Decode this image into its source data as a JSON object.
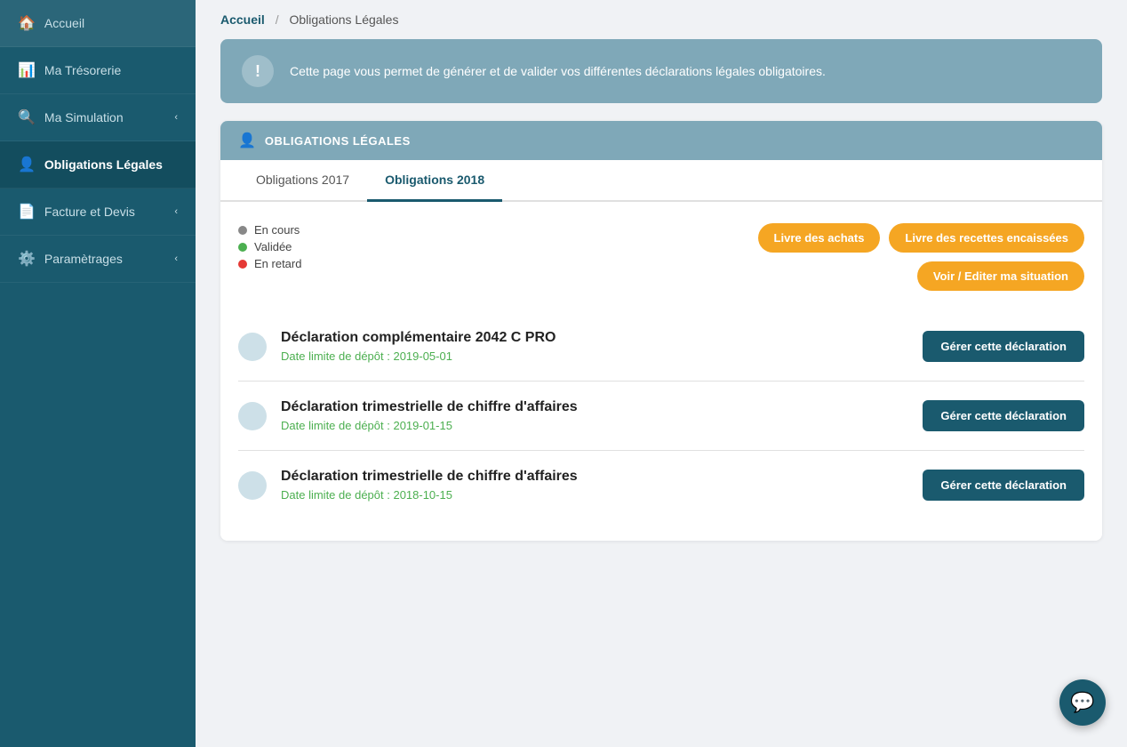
{
  "sidebar": {
    "items": [
      {
        "id": "accueil",
        "label": "Accueil",
        "icon": "🏠",
        "active": false
      },
      {
        "id": "tresorerie",
        "label": "Ma Trésorerie",
        "icon": "📊",
        "active": false
      },
      {
        "id": "simulation",
        "label": "Ma Simulation",
        "icon": "🔍",
        "active": false,
        "hasArrow": true
      },
      {
        "id": "obligations",
        "label": "Obligations Légales",
        "icon": "👤",
        "active": true
      },
      {
        "id": "facture",
        "label": "Facture et Devis",
        "icon": "📄",
        "active": false,
        "hasArrow": true
      },
      {
        "id": "parametrages",
        "label": "Paramètrages",
        "icon": "⚙️",
        "active": false,
        "hasArrow": true
      }
    ]
  },
  "breadcrumb": {
    "home": "Accueil",
    "sep": "/",
    "current": "Obligations Légales"
  },
  "info_banner": {
    "text": "Cette page vous permet de générer et de valider vos différentes déclarations légales obligatoires."
  },
  "panel": {
    "icon": "👤",
    "title": "OBLIGATIONS LÉGALES",
    "tabs": [
      {
        "id": "2017",
        "label": "Obligations 2017",
        "active": false
      },
      {
        "id": "2018",
        "label": "Obligations 2018",
        "active": true
      }
    ],
    "legend": [
      {
        "id": "en-cours",
        "color": "gray",
        "label": "En cours"
      },
      {
        "id": "validee",
        "color": "green",
        "label": "Validée"
      },
      {
        "id": "en-retard",
        "color": "red",
        "label": "En retard"
      }
    ],
    "buttons": [
      {
        "id": "livre-achats",
        "label": "Livre des achats"
      },
      {
        "id": "livre-recettes",
        "label": "Livre des recettes encaissées"
      },
      {
        "id": "voir-editer",
        "label": "Voir / Editer ma situation"
      }
    ],
    "declarations": [
      {
        "id": "decl-1",
        "title": "Déclaration complémentaire 2042 C PRO",
        "date_label": "Date limite de dépôt : 2019-05-01",
        "btn_label": "Gérer cette déclaration"
      },
      {
        "id": "decl-2",
        "title": "Déclaration trimestrielle de chiffre d'affaires",
        "date_label": "Date limite de dépôt : 2019-01-15",
        "btn_label": "Gérer cette déclaration"
      },
      {
        "id": "decl-3",
        "title": "Déclaration trimestrielle de chiffre d'affaires",
        "date_label": "Date limite de dépôt : 2018-10-15",
        "btn_label": "Gérer cette déclaration"
      }
    ]
  },
  "chat": {
    "icon": "💬"
  }
}
